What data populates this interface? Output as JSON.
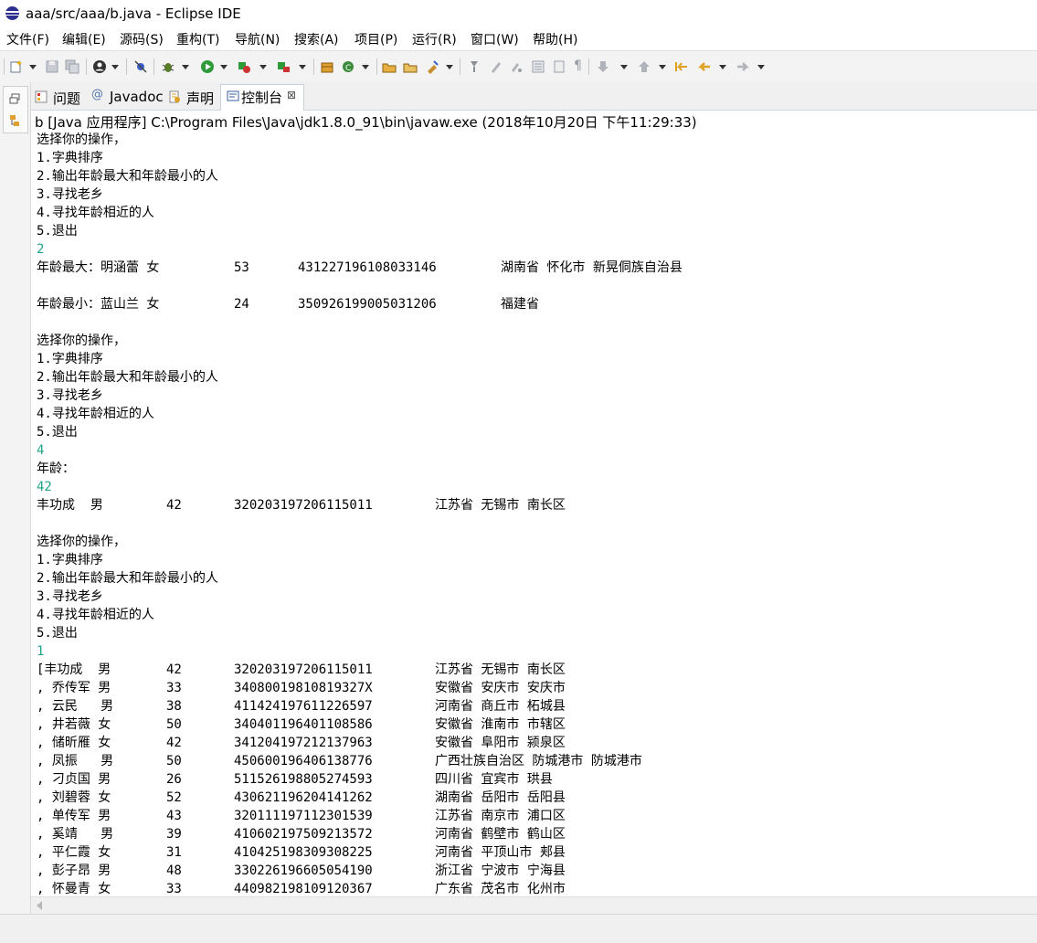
{
  "window": {
    "title": "aaa/src/aaa/b.java - Eclipse IDE"
  },
  "menu": [
    {
      "label": "文件(F)"
    },
    {
      "label": "编辑(E)"
    },
    {
      "label": "源码(S)"
    },
    {
      "label": "重构(T)"
    },
    {
      "label": "导航(N)"
    },
    {
      "label": "搜索(A)"
    },
    {
      "label": "项目(P)"
    },
    {
      "label": "运行(R)"
    },
    {
      "label": "窗口(W)"
    },
    {
      "label": "帮助(H)"
    }
  ],
  "tabs": [
    {
      "label": "问题",
      "icon": "problems-icon",
      "active": false
    },
    {
      "label": "Javadoc",
      "icon": "javadoc-icon",
      "active": false
    },
    {
      "label": "声明",
      "icon": "declaration-icon",
      "active": false
    },
    {
      "label": "控制台",
      "icon": "console-icon",
      "active": true,
      "close": "⊠"
    }
  ],
  "console": {
    "header": "b [Java 应用程序] C:\\Program Files\\Java\\jdk1.8.0_91\\bin\\javaw.exe  (2018年10月20日 下午11:29:33)",
    "input_color": "#1fa58c",
    "lines": [
      {
        "text": "选择你的操作，"
      },
      {
        "text": "1.字典排序"
      },
      {
        "text": "2.输出年龄最大和年龄最小的人"
      },
      {
        "text": "3.寻找老乡"
      },
      {
        "text": "4.寻找年龄相近的人"
      },
      {
        "text": "5.退出"
      },
      {
        "text": "2",
        "input": true
      },
      {
        "cols": [
          "年龄最大：明涵蕾 女",
          "53",
          "431227196108033146",
          "湖南省 怀化市 新晃侗族自治县"
        ],
        "pos": "wide"
      },
      {
        "text": ""
      },
      {
        "cols": [
          "年龄最小：蓝山兰 女",
          "24",
          "350926199005031206",
          "福建省"
        ],
        "pos": "wide"
      },
      {
        "text": ""
      },
      {
        "text": "选择你的操作，"
      },
      {
        "text": "1.字典排序"
      },
      {
        "text": "2.输出年龄最大和年龄最小的人"
      },
      {
        "text": "3.寻找老乡"
      },
      {
        "text": "4.寻找年龄相近的人"
      },
      {
        "text": "5.退出"
      },
      {
        "text": "4",
        "input": true
      },
      {
        "text": "年龄："
      },
      {
        "text": "42",
        "input": true
      },
      {
        "cols": [
          "丰功成  男",
          "42",
          "320203197206115011",
          "江苏省 无锡市 南长区"
        ],
        "pos": "narrow"
      },
      {
        "text": ""
      },
      {
        "text": "选择你的操作，"
      },
      {
        "text": "1.字典排序"
      },
      {
        "text": "2.输出年龄最大和年龄最小的人"
      },
      {
        "text": "3.寻找老乡"
      },
      {
        "text": "4.寻找年龄相近的人"
      },
      {
        "text": "5.退出"
      },
      {
        "text": "1",
        "input": true
      },
      {
        "cols": [
          "[丰功成  男",
          "42",
          "320203197206115011",
          "江苏省 无锡市 南长区"
        ],
        "pos": "narrow"
      },
      {
        "cols": [
          ", 乔传军 男",
          "33",
          "34080019810819327X",
          "安徽省 安庆市 安庆市"
        ],
        "pos": "narrow"
      },
      {
        "cols": [
          ", 云民   男",
          "38",
          "411424197611226597",
          "河南省 商丘市 柘城县"
        ],
        "pos": "narrow"
      },
      {
        "cols": [
          ", 井若薇 女",
          "50",
          "340401196401108586",
          "安徽省 淮南市 市辖区"
        ],
        "pos": "narrow"
      },
      {
        "cols": [
          ", 储昕雁 女",
          "42",
          "341204197212137963",
          "安徽省 阜阳市 颍泉区"
        ],
        "pos": "narrow"
      },
      {
        "cols": [
          ", 凤振   男",
          "50",
          "450600196406138776",
          "广西壮族自治区 防城港市 防城港市"
        ],
        "pos": "narrow"
      },
      {
        "cols": [
          ", 刁贞国 男",
          "26",
          "511526198805274593",
          "四川省 宜宾市 珙县"
        ],
        "pos": "narrow"
      },
      {
        "cols": [
          ", 刘碧蓉 女",
          "52",
          "430621196204141262",
          "湖南省 岳阳市 岳阳县"
        ],
        "pos": "narrow"
      },
      {
        "cols": [
          ", 单传军 男",
          "43",
          "320111197112301539",
          "江苏省 南京市 浦口区"
        ],
        "pos": "narrow"
      },
      {
        "cols": [
          ", 奚靖   男",
          "39",
          "410602197509213572",
          "河南省 鹤壁市 鹤山区"
        ],
        "pos": "narrow"
      },
      {
        "cols": [
          ", 平仁霞 女",
          "31",
          "410425198309308225",
          "河南省 平顶山市 郏县"
        ],
        "pos": "narrow"
      },
      {
        "cols": [
          ", 彭子昂 男",
          "48",
          "330226196605054190",
          "浙江省 宁波市 宁海县"
        ],
        "pos": "narrow"
      },
      {
        "cols": [
          ", 怀曼青 女",
          "33",
          "440982198109120367",
          "广东省 茂名市 化州市"
        ],
        "pos": "narrow"
      }
    ]
  }
}
